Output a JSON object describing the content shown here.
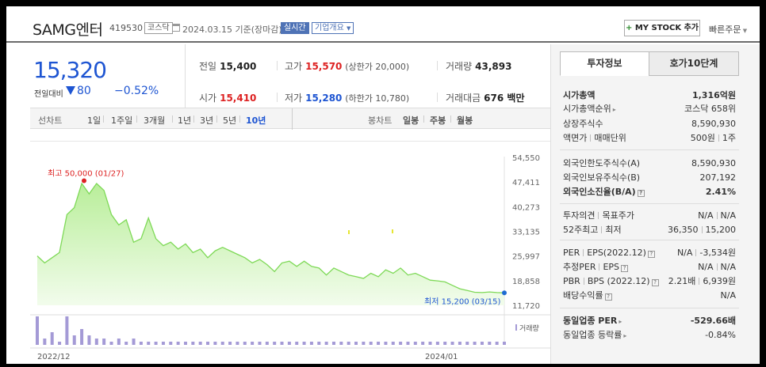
{
  "header": {
    "stock_name": "SAMG엔터",
    "stock_code": "419530",
    "market": "코스닥",
    "date": "2024.03.15",
    "date_suffix": "기준(장마감)",
    "realtime": "실시간",
    "corp_info": "기업개요",
    "my_stock": "MY STOCK 추가",
    "quick_order": "빠른주문"
  },
  "price": {
    "current": "15,320",
    "change_label": "전일대비",
    "change": "80",
    "change_pct": "−0.52%"
  },
  "quotes": {
    "prev_label": "전일",
    "prev": "15,400",
    "high_label": "고가",
    "high": "15,570",
    "upper_limit": "(상한가 20,000)",
    "volume_label": "거래량",
    "volume": "43,893",
    "open_label": "시가",
    "open": "15,410",
    "low_label": "저가",
    "low": "15,280",
    "lower_limit": "(하한가 10,780)",
    "amount_label": "거래대금",
    "amount": "676 백만"
  },
  "periods": {
    "line_label": "선차트",
    "items": [
      "1일",
      "1주일",
      "3개월",
      "1년",
      "3년",
      "5년",
      "10년"
    ],
    "active": "10년",
    "candle_label": "봉차트",
    "candle_items": [
      "일봉",
      "주봉",
      "월봉"
    ]
  },
  "chart_data": {
    "type": "area",
    "x_labels": [
      "2022/12",
      "2024/01"
    ],
    "y_ticks": [
      54550,
      47411,
      40273,
      33135,
      25997,
      18858,
      11720
    ],
    "ylim": [
      11720,
      54550
    ],
    "high_annotation": "최고 50,000 (01/27)",
    "low_annotation": "최저 15,200 (03/15)",
    "volume_legend": "거래량",
    "values": [
      26000,
      24000,
      25500,
      27000,
      38000,
      40000,
      47000,
      44000,
      47000,
      45000,
      38000,
      35000,
      36500,
      30000,
      31000,
      37000,
      31000,
      29000,
      30000,
      28000,
      29500,
      27000,
      28000,
      25500,
      27500,
      28500,
      27500,
      26500,
      25500,
      24000,
      25000,
      23500,
      21500,
      24000,
      24500,
      23000,
      24500,
      23000,
      22500,
      20500,
      22500,
      21500,
      20500,
      20000,
      19500,
      21000,
      20000,
      22000,
      21000,
      22500,
      20500,
      21000,
      20000,
      19000,
      18800,
      18500,
      17500,
      16500,
      16000,
      15500,
      15400,
      15600,
      15400,
      15320
    ],
    "volumes": [
      9,
      2,
      4,
      1,
      9,
      3,
      5,
      3,
      2,
      2,
      1,
      2,
      1,
      2,
      1,
      1,
      1,
      1,
      1,
      1,
      1,
      1,
      1,
      1,
      1,
      1,
      1,
      1,
      1,
      1,
      1,
      1,
      1,
      1,
      1,
      1,
      1,
      1,
      1,
      1,
      1,
      1,
      1,
      1,
      1,
      1,
      1,
      1,
      1,
      1,
      1,
      1,
      1,
      1,
      1,
      1,
      1,
      1,
      1,
      1,
      1,
      1,
      1,
      1
    ],
    "colors": {
      "line": "#7ed957",
      "fill_top": "#b9ee9a",
      "fill_bottom": "#f2fcec",
      "volume": "#a49ad6",
      "high_dot": "#d22",
      "low_dot": "#1e6bd2"
    }
  },
  "panel": {
    "tab_active": "투자정보",
    "tab_other": "호가10단계",
    "mcap_label": "시가총액",
    "mcap": "1,316억원",
    "mcap_rank_label": "시가총액순위",
    "mcap_rank": "코스닥 658위",
    "shares_label": "상장주식수",
    "shares": "8,590,930",
    "par_label": "액면가",
    "unit_label": "매매단위",
    "par": "500원",
    "unit": "1주",
    "foreign_limit_label": "외국인한도주식수(A)",
    "foreign_limit": "8,590,930",
    "foreign_hold_label": "외국인보유주식수(B)",
    "foreign_hold": "207,192",
    "foreign_ratio_label": "외국인소진율(B/A)",
    "foreign_ratio": "2.41%",
    "opinion_label": "투자의견",
    "target_label": "목표주가",
    "opinion": "N/A",
    "target": "N/A",
    "w52_label": "52주최고",
    "w52_low_label": "최저",
    "w52_high": "36,350",
    "w52_low": "15,200",
    "per_label": "PER",
    "eps_label": "EPS(2022.12)",
    "per": "N/A",
    "eps": "-3,534원",
    "est_per_label": "추정PER",
    "est_eps_label": "EPS",
    "est_per": "N/A",
    "est_eps": "N/A",
    "pbr_label": "PBR",
    "bps_label": "BPS (2022.12)",
    "pbr": "2.21배",
    "bps": "6,939원",
    "div_label": "배당수익률",
    "div": "N/A",
    "ind_per_label": "동일업종 PER",
    "ind_per": "-529.66배",
    "ind_rate_label": "동일업종 등락률",
    "ind_rate": "-0.84%"
  }
}
